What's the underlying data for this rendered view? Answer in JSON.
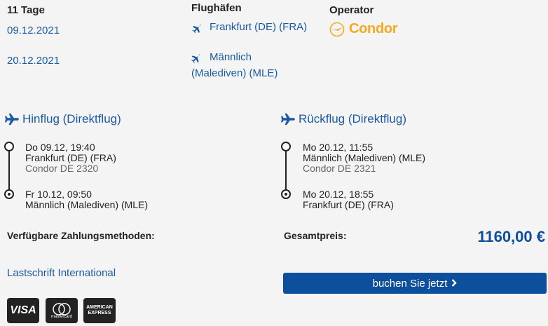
{
  "trip": {
    "duration": "11 Tage",
    "depart_date": "09.12.2021",
    "return_date": "20.12.2021"
  },
  "airports": {
    "heading": "Flughäfen",
    "from": "Frankfurt (DE) (FRA)",
    "to_line1": "Männlich",
    "to_line2": "(Malediven) (MLE)"
  },
  "operator": {
    "heading": "Operator",
    "name": "Condor"
  },
  "outbound": {
    "title": "Hinflug (Direktflug)",
    "dep_time": "Do 09.12, 19:40",
    "dep_airport": "Frankfurt (DE) (FRA)",
    "flight": "Condor DE 2320",
    "arr_time": "Fr 10.12, 09:50",
    "arr_airport": "Männlich (Malediven) (MLE)"
  },
  "inbound": {
    "title": "Rückflug (Direktflug)",
    "dep_time": "Mo 20.12, 11:55",
    "dep_airport": "Männlich (Malediven) (MLE)",
    "flight": "Condor DE 2321",
    "arr_time": "Mo 20.12, 18:55",
    "arr_airport": "Frankfurt (DE) (FRA)"
  },
  "payment": {
    "heading": "Verfügbare Zahlungsmethoden:",
    "method": "Lastschrift International",
    "cards": {
      "visa": "VISA",
      "mastercard": "mastercard",
      "amex_line1": "AMERICAN",
      "amex_line2": "EXPRESS"
    }
  },
  "total": {
    "label": "Gesamtpreis:",
    "price": "1160,00 €"
  },
  "book_button": {
    "label": "buchen Sie jetzt"
  },
  "colors": {
    "accent": "#0d4f9c",
    "link": "#1a5aa3",
    "condor": "#f6a821"
  }
}
